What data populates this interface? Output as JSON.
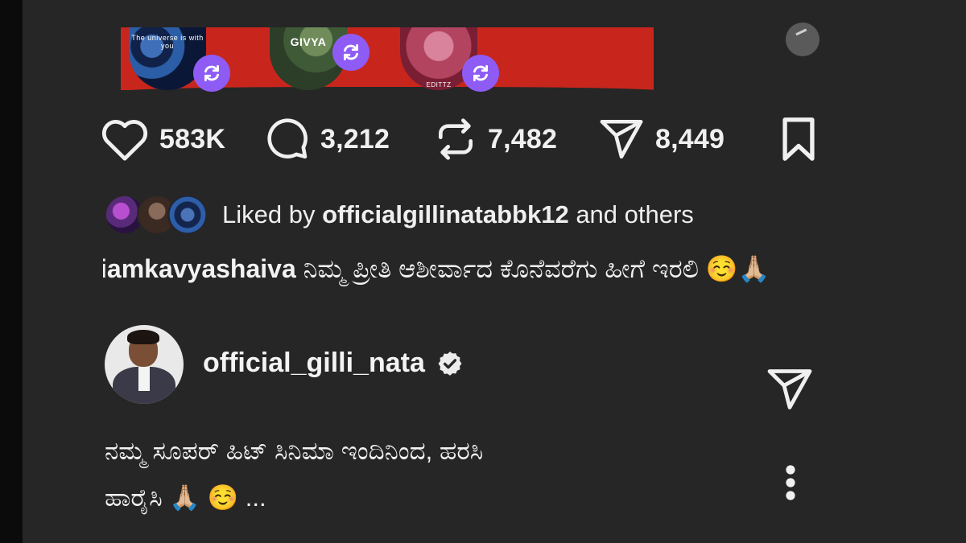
{
  "media": {
    "reels": [
      {
        "overlay_text": "The universe is with you"
      },
      {
        "overlay_text": "GIVYA"
      },
      {
        "overlay_text": "EDITTZ"
      }
    ]
  },
  "actions": {
    "likes": "583K",
    "comments": "3,212",
    "reposts": "7,482",
    "shares": "8,449"
  },
  "liked_by": {
    "prefix": "Liked by ",
    "user": "officialgillinatabbk12",
    "suffix": " and others"
  },
  "caption": {
    "username": "iamkavyashaiva",
    "text": " ನಿಮ್ಮ ಪ್ರೀತಿ ಆಶೀರ್ವಾದ ಕೊನೆವರೆಗು ಹೀಗೆ ಇರಲಿ ☺️🙏🏼"
  },
  "profile": {
    "username": "official_gilli_nata",
    "verified": true
  },
  "post_caption": {
    "line1": "ನಮ್ಮ ಸೂಪರ್ ಹಿಟ್ ಸಿನಿಮಾ ಇಂದಿನಿಂದ, ಹರಸಿ",
    "line2": "ಹಾರೈಸಿ 🙏🏼 ☺️ ..."
  },
  "colors": {
    "background": "#262626",
    "repost_badge": "#8e5cf5",
    "text": "#f2f2f2"
  },
  "icons": [
    "heart-icon",
    "comment-icon",
    "repost-icon",
    "share-icon",
    "bookmark-icon",
    "verified-icon",
    "send-icon",
    "more-vertical-icon"
  ]
}
